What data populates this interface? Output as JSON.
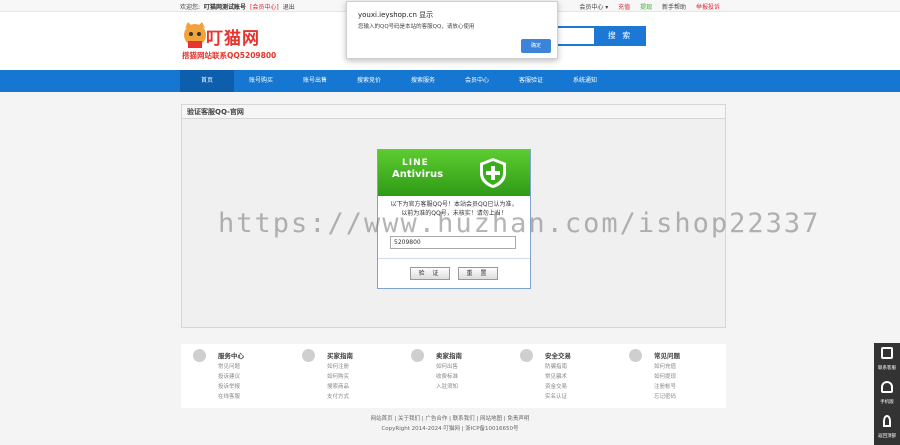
{
  "topbar": {
    "welcome": "欢迎您:",
    "username": "叮猫网测试账号",
    "member_center_link": "[会员中心]",
    "logout": "退出",
    "member_menu": "会员中心 ▾",
    "recharge": "充值",
    "withdraw": "提现",
    "newbie_help": "新手帮助",
    "report": "举报投诉"
  },
  "header": {
    "logo_name": "叮猫网",
    "logo_tel": "搭猫网站联系QQ5209800",
    "search_button": "搜 索"
  },
  "nav": {
    "items": [
      "首页",
      "账号购买",
      "账号出售",
      "搜索竞价",
      "搜索服务",
      "会员中心",
      "客服验证",
      "系统通知"
    ]
  },
  "panel": {
    "title": "验证客服QQ-官网"
  },
  "verify": {
    "banner_line1": "LINE",
    "banner_line2": "Antivirus",
    "message": "以下为官方客服QQ号！本站会员QQ已认为准，\n以前为准的QQ号，未核实！请勿上当！",
    "qq_value": "5209800",
    "confirm_button": "验 证",
    "reset_button": "重 置"
  },
  "footer_links": [
    {
      "title": "服务中心",
      "items": [
        "常见问题",
        "投诉建议",
        "投诉举报",
        "在线客服"
      ]
    },
    {
      "title": "买家指南",
      "items": [
        "如何注册",
        "如何购买",
        "搜索商品",
        "支付方式"
      ]
    },
    {
      "title": "卖家指南",
      "items": [
        "如何出售",
        "收费标准",
        "入驻须知"
      ]
    },
    {
      "title": "安全交易",
      "items": [
        "防骗指南",
        "常见骗术",
        "资金交易",
        "实名认证"
      ]
    },
    {
      "title": "常见问题",
      "items": [
        "如何充值",
        "如何提现",
        "注册帐号",
        "忘记密码"
      ]
    }
  ],
  "footer_bottom": {
    "links": "网站首页 | 关于我们 | 广告合作 | 联系我们 | 网站地图 | 免责声明",
    "copyright": "CopyRight 2014-2024 叮猫网 | 浙ICP备10016650号"
  },
  "watermark": "https://www.huzhan.com/ishop22337",
  "side_tools": [
    {
      "label": "联系客服",
      "icon": "chat-icon"
    },
    {
      "label": "手机版",
      "icon": "headset-icon"
    },
    {
      "label": "返回顶部",
      "icon": "rocket-icon"
    }
  ],
  "dialog": {
    "title": "youxi.ieyshop.cn 显示",
    "message": "您输入的QQ号码是本站的客服QQ，请放心使用",
    "ok_button": "确定"
  },
  "colors": {
    "brand_blue": "#1577d1",
    "logo_red": "#e8342e",
    "banner_green": "#3aad1d"
  }
}
